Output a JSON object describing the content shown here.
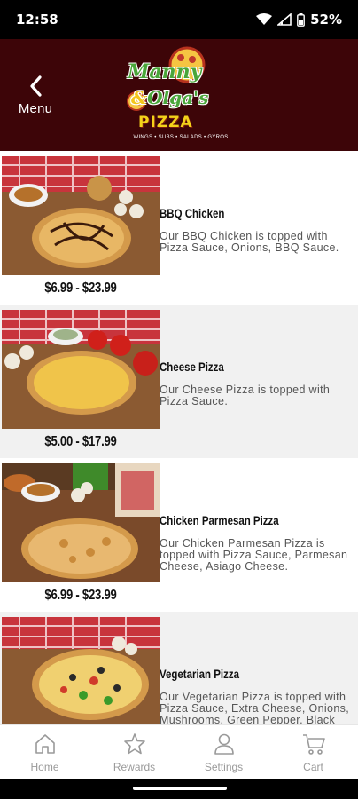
{
  "status": {
    "time": "12:58",
    "battery": "52%"
  },
  "header": {
    "menu_label": "Menu",
    "logo": {
      "line1": "Manny",
      "amp": "&",
      "line2": "Olga's",
      "pizza": "PIZZA",
      "tagline": "WINGS • SUBS • SALADS • GYROS"
    }
  },
  "items": [
    {
      "title": "BBQ Chicken",
      "description": "Our BBQ Chicken is topped with Pizza Sauce, Onions, BBQ Sauce.",
      "price": "$6.99 - $23.99"
    },
    {
      "title": "Cheese Pizza",
      "description": "Our Cheese Pizza is topped with Pizza Sauce.",
      "price": "$5.00 - $17.99"
    },
    {
      "title": "Chicken Parmesan Pizza",
      "description": "Our Chicken Parmesan Pizza is topped with Pizza Sauce, Parmesan Cheese, Asiago Cheese.",
      "price": "$6.99 - $23.99"
    },
    {
      "title": "Vegetarian Pizza",
      "description": "Our Vegetarian Pizza is topped with Pizza Sauce, Extra Cheese, Onions, Mushrooms, Green Pepper, Black Olive, Green Olive, Sliced",
      "price": ""
    }
  ],
  "tabs": [
    {
      "label": "Home",
      "icon": "home-icon"
    },
    {
      "label": "Rewards",
      "icon": "star-icon"
    },
    {
      "label": "Settings",
      "icon": "person-icon"
    },
    {
      "label": "Cart",
      "icon": "cart-icon"
    }
  ],
  "colors": {
    "header_bg": "#3d0508",
    "tab_inactive": "#9a9a9a"
  }
}
